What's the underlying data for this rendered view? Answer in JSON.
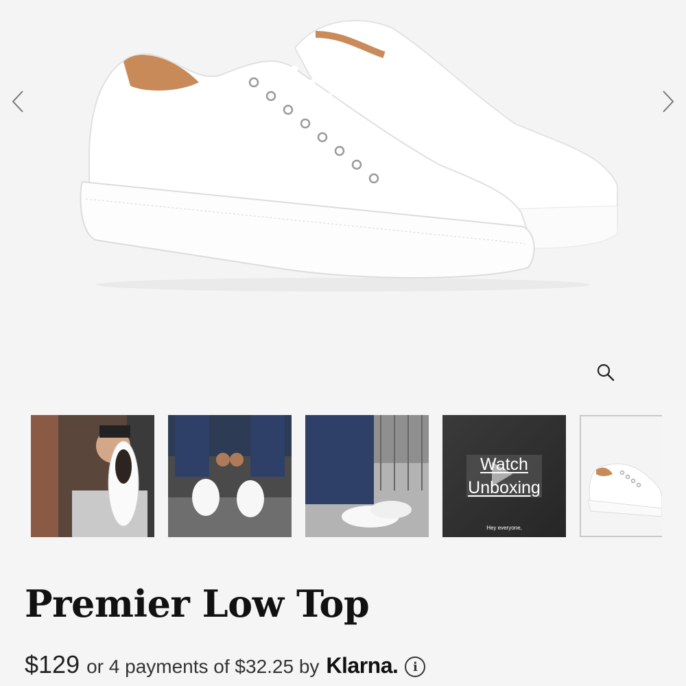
{
  "gallery": {
    "main_image_alt": "White leather low top sneakers",
    "prev_icon": "chevron-left-icon",
    "next_icon": "chevron-right-icon",
    "zoom_icon": "magnifier-icon",
    "thumbnails": [
      {
        "kind": "photo"
      },
      {
        "kind": "photo"
      },
      {
        "kind": "photo"
      },
      {
        "kind": "video",
        "line1": "Watch",
        "line2": "Unboxing",
        "caption": "Hey everyone,"
      },
      {
        "kind": "photo",
        "selected": true
      }
    ]
  },
  "product": {
    "title": "Premier Low Top",
    "price": "$129",
    "installment_text": "or 4 payments of $32.25 by",
    "provider": "Klarna.",
    "info_icon": "info-icon"
  },
  "colors": {
    "background": "#f4f4f4",
    "text": "#111111"
  }
}
